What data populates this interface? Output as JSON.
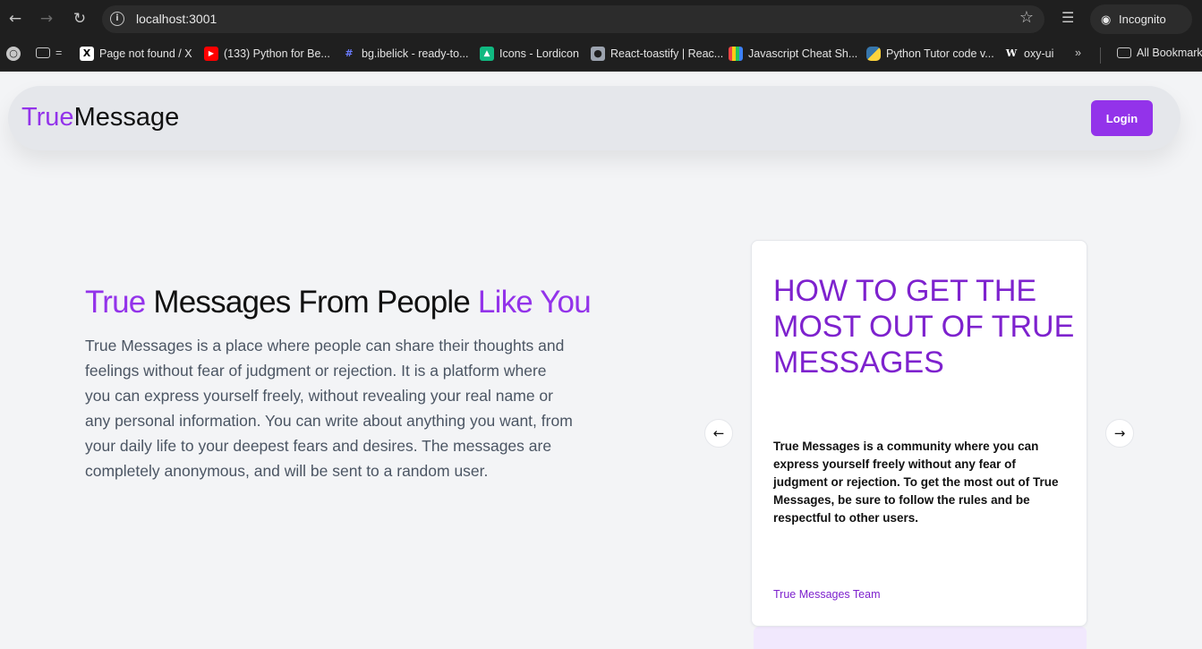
{
  "browser": {
    "url": "localhost:3001",
    "profile_label": "Incognito",
    "bookmarks": [
      {
        "label": "",
        "icon": "folder-icon"
      },
      {
        "label": "Page not found / X",
        "icon": "x-logo-icon"
      },
      {
        "label": "(133) Python for Be...",
        "icon": "youtube-icon"
      },
      {
        "label": "bg.ibelick - ready-to...",
        "icon": "hash-icon"
      },
      {
        "label": "Icons - Lordicon",
        "icon": "lordicon-icon"
      },
      {
        "label": "React-toastify | Reac...",
        "icon": "toastify-icon"
      },
      {
        "label": "Javascript Cheat Sh...",
        "icon": "cheatsheet-icon"
      },
      {
        "label": "Python Tutor code v...",
        "icon": "python-icon"
      },
      {
        "label": "oxy-ui",
        "icon": "w-icon"
      }
    ],
    "more_label": "»",
    "all_bookmarks_label": "All Bookmarks"
  },
  "app": {
    "logo_accent": "True",
    "logo_rest": "Message",
    "login_label": "Login",
    "accent_color": "#9333ea"
  },
  "hero": {
    "title_accent1": "True",
    "title_mid": " Messages From People ",
    "title_accent2": "Like You",
    "paragraph": "True Messages is a place where people can share their thoughts and feelings without fear of judgment or rejection. It is a platform where you can express yourself freely, without revealing your real name or any personal information. You can write about anything you want, from your daily life to your deepest fears and desires. The messages are completely anonymous, and will be sent to a random user."
  },
  "card": {
    "title": "How to get the most out of True Messages",
    "body": "True Messages is a community where you can express yourself freely without any fear of judgment or rejection. To get the most out of True Messages, be sure to follow the rules and be respectful to other users.",
    "footer": "True Messages Team"
  }
}
